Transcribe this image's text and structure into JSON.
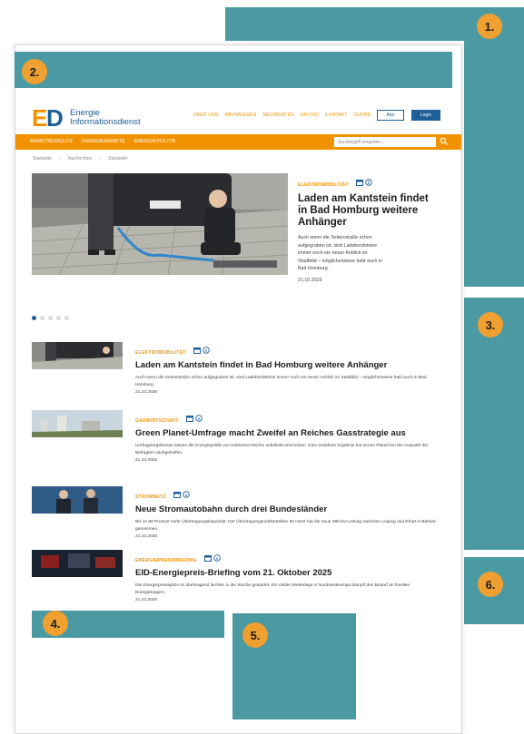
{
  "callouts": [
    {
      "number": "1."
    },
    {
      "number": "2."
    },
    {
      "number": "3."
    },
    {
      "number": "4."
    },
    {
      "number": "5."
    },
    {
      "number": "6."
    }
  ],
  "site": {
    "logo_line1": "Energie",
    "logo_line2": "Informationsdienst",
    "top_nav": [
      "ÜBER UNS",
      "ABONNIEREN",
      "MEDIADATEN",
      "ARCHIV",
      "KONTAKT",
      "SUCHE"
    ],
    "abo_button": "Abo",
    "login_button": "Login",
    "orange_nav": [
      "MARKTBERICHTE",
      "ENERGIEMÄRKTE",
      "ENERGIEPOLITIK"
    ],
    "search_placeholder": "Suchbegriff eingeben...",
    "breadcrumb": [
      "Startseite",
      "Nachrichten",
      "Startseite"
    ]
  },
  "hero": {
    "tag": "ELEKTROMOBILITÄT",
    "title": "Laden am Kantstein findet in Bad Homburg weitere Anhänger",
    "teaser": "Auch wenn die Seitenstraße schon aufgegraben ist, sind Ladebordsteine immer noch ein neuer Anblick im Stadtbild – möglicherweise bald auch in Bad Homburg.",
    "date": "21.10.2025"
  },
  "carousel": {
    "active": 0,
    "count": 5
  },
  "articles": [
    {
      "tag": "ELEKTROMOBILITÄT",
      "title": "Laden am Kantstein findet in Bad Homburg weitere Anhänger",
      "teaser": "Auch wenn die Seitenstraße schon aufgegraben ist, sind Ladebordsteine immer noch ein neuer Anblick im Stadtbild – möglicherweise bald auch in Bad Homburg.",
      "date": "21.10.2025"
    },
    {
      "tag": "GASWIRTSCHAFT",
      "title": "Green Planet-Umfrage macht Zweifel an Reiches Gasstrategie aus",
      "teaser": "Umfrageergebnisse lassen die Energiepolitik von Katherina Reiche unbeliebt erscheinen. Eine erwähnte Ergebnis hat Green Planet bei der Auswahl der Befragten nachgeholfen.",
      "date": "21.10.2025"
    },
    {
      "tag": "STROMNETZ",
      "title": "Neue Stromautobahn durch drei Bundesländer",
      "teaser": "Bis zu 80 Prozent mehr Übertragungskapazität: Der Übertragungsnetzbetreiber 50 Hertz hat die neue 380-kV-Leitung zwischen Leipzig und Erfurt in Betrieb genommen.",
      "date": "21.10.2025"
    },
    {
      "tag": "ENERGIEPREISBRIEFING",
      "title": "EID-Energiepreis-Briefing vom 21. Oktober 2025",
      "teaser": "Die Energiepreisspitze ist übertragend leichter in die Woche gestartet. Ein milder Wetterlage in Nordwesteuropa dämpft den Bedarf an fossilen Energieträgern.",
      "date": "21.10.2025"
    }
  ],
  "colors": {
    "callout": "#4b9aa3",
    "badge": "#f0a030",
    "brand_orange": "#f39200",
    "brand_blue": "#1d5f98"
  }
}
